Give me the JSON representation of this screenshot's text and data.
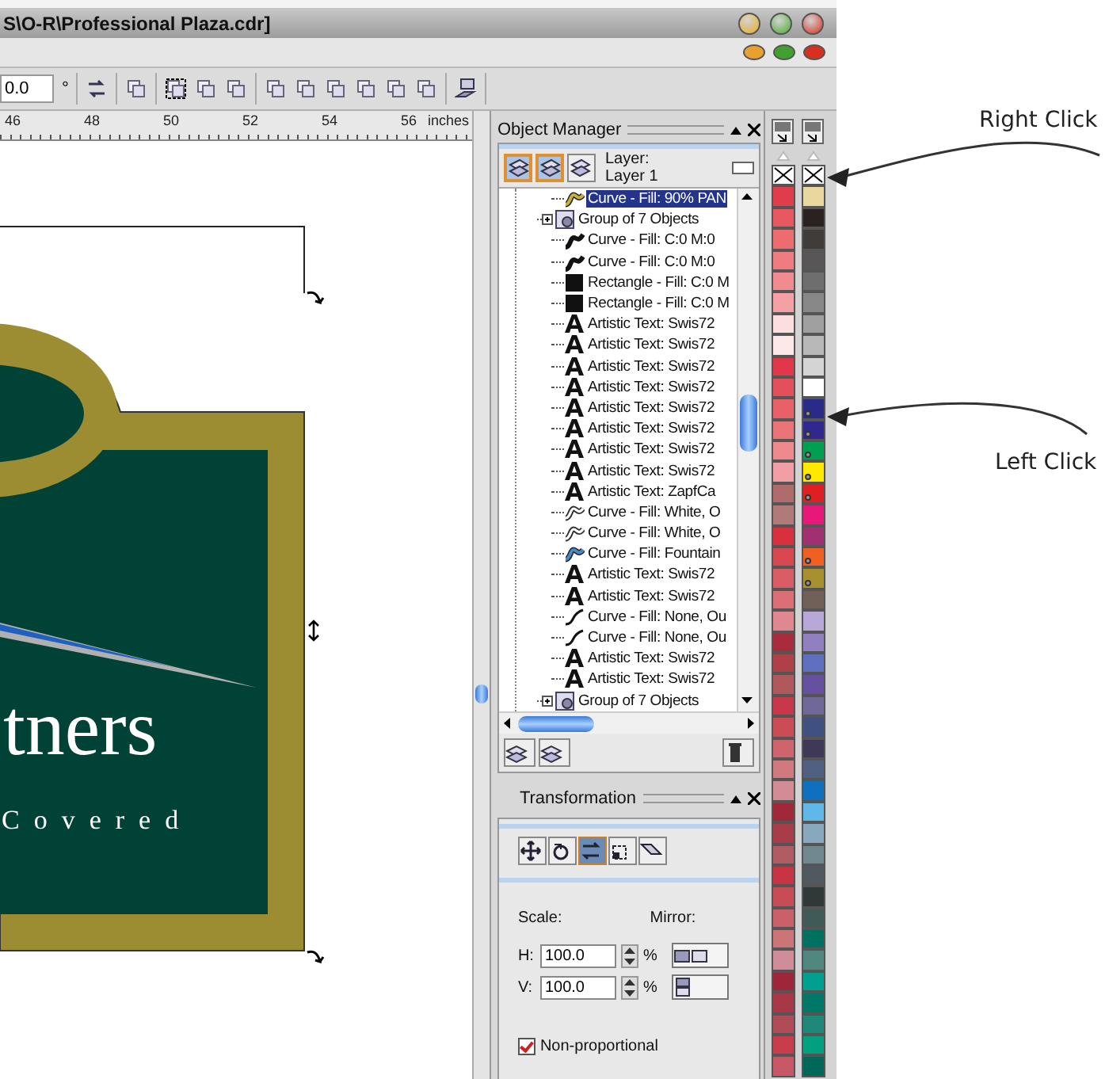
{
  "window": {
    "title": "S\\O-R\\Professional Plaza.cdr]"
  },
  "toolbar": {
    "angle_value": "0.0",
    "angle_unit": "°"
  },
  "ruler": {
    "labels": [
      "46",
      "48",
      "50",
      "52",
      "54",
      "56"
    ],
    "unit": "inches"
  },
  "canvas": {
    "texts": [
      "tners",
      "Covered"
    ]
  },
  "object_manager": {
    "title": "Object Manager",
    "layer_label": "Layer:",
    "layer_name": "Layer 1",
    "layer_buttons": [
      {
        "on": true
      },
      {
        "on": true
      },
      {
        "on": false
      }
    ],
    "rows": [
      {
        "label": "Curve - Fill: 90% PAN",
        "kind": "goldcurve",
        "selected": true
      },
      {
        "label": "Group of 7 Objects",
        "kind": "group",
        "selected": false,
        "expanded": false
      },
      {
        "label": "Curve - Fill: C:0 M:0",
        "kind": "blackcurve",
        "selected": false
      },
      {
        "label": "Curve - Fill: C:0 M:0",
        "kind": "blackcurve",
        "selected": false
      },
      {
        "label": "Rectangle - Fill: C:0 M",
        "kind": "rectangle",
        "selected": false
      },
      {
        "label": "Rectangle - Fill: C:0 M",
        "kind": "rectangle",
        "selected": false
      },
      {
        "label": "Artistic Text: Swis72",
        "kind": "text",
        "selected": false
      },
      {
        "label": "Artistic Text: Swis72",
        "kind": "text",
        "selected": false
      },
      {
        "label": "Artistic Text: Swis72",
        "kind": "text",
        "selected": false
      },
      {
        "label": "Artistic Text: Swis72",
        "kind": "text",
        "selected": false
      },
      {
        "label": "Artistic Text: Swis72",
        "kind": "text",
        "selected": false
      },
      {
        "label": "Artistic Text: Swis72",
        "kind": "text",
        "selected": false
      },
      {
        "label": "Artistic Text: Swis72",
        "kind": "text",
        "selected": false
      },
      {
        "label": "Artistic Text: Swis72",
        "kind": "text",
        "selected": false
      },
      {
        "label": "Artistic Text: ZapfCa",
        "kind": "text",
        "selected": false
      },
      {
        "label": "Curve - Fill: White, O",
        "kind": "whitecurve",
        "selected": false
      },
      {
        "label": "Curve - Fill: White, O",
        "kind": "whitecurve",
        "selected": false
      },
      {
        "label": "Curve - Fill: Fountain",
        "kind": "bluecurve",
        "selected": false
      },
      {
        "label": "Artistic Text: Swis72",
        "kind": "text",
        "selected": false
      },
      {
        "label": "Artistic Text: Swis72",
        "kind": "text",
        "selected": false
      },
      {
        "label": "Curve - Fill: None, Ou",
        "kind": "line",
        "selected": false
      },
      {
        "label": "Curve - Fill: None, Ou",
        "kind": "line",
        "selected": false
      },
      {
        "label": "Artistic Text: Swis72",
        "kind": "text",
        "selected": false
      },
      {
        "label": "Artistic Text: Swis72",
        "kind": "text",
        "selected": false
      },
      {
        "label": "Group of 7 Objects",
        "kind": "group",
        "selected": false,
        "expanded": false
      }
    ]
  },
  "transformation": {
    "title": "Transformation",
    "modes": [
      {
        "selected": false
      },
      {
        "selected": false
      },
      {
        "selected": true
      },
      {
        "selected": false
      },
      {
        "selected": false
      }
    ],
    "scale_label": "Scale:",
    "mirror_label": "Mirror:",
    "fields": [
      {
        "label": "H:",
        "value": "100.0",
        "unit": "%"
      },
      {
        "label": "V:",
        "value": "100.0",
        "unit": "%"
      }
    ],
    "non_proportional": {
      "label": "Non-proportional",
      "checked": true
    }
  },
  "palettes": [
    {
      "swatches": [
        {
          "kind": "none"
        },
        {
          "kind": "color",
          "color": "#e03c4c"
        },
        {
          "kind": "color",
          "color": "#e85860"
        },
        {
          "kind": "color",
          "color": "#ec6c70"
        },
        {
          "kind": "color",
          "color": "#ee7c80"
        },
        {
          "kind": "color",
          "color": "#f08c90"
        },
        {
          "kind": "color",
          "color": "#f4a0a4"
        },
        {
          "kind": "color",
          "color": "#fcdede"
        },
        {
          "kind": "color",
          "color": "#fce8e8"
        },
        {
          "kind": "color",
          "color": "#e0384a"
        },
        {
          "kind": "color",
          "color": "#e4505a"
        },
        {
          "kind": "color",
          "color": "#e86068"
        },
        {
          "kind": "color",
          "color": "#ea7478"
        },
        {
          "kind": "color",
          "color": "#ee8a8e"
        },
        {
          "kind": "color",
          "color": "#f0a0a4"
        },
        {
          "kind": "color",
          "color": "#b06c6c"
        },
        {
          "kind": "color",
          "color": "#b07a78"
        },
        {
          "kind": "color",
          "color": "#d8303e"
        },
        {
          "kind": "color",
          "color": "#d84850"
        },
        {
          "kind": "color",
          "color": "#da5c64"
        },
        {
          "kind": "color",
          "color": "#dc6e76"
        },
        {
          "kind": "color",
          "color": "#e08890"
        },
        {
          "kind": "color",
          "color": "#a82c3c"
        },
        {
          "kind": "color",
          "color": "#b04048"
        },
        {
          "kind": "color",
          "color": "#b0585c"
        },
        {
          "kind": "color",
          "color": "#c8384a"
        },
        {
          "kind": "color",
          "color": "#cc4c56"
        },
        {
          "kind": "color",
          "color": "#d0646c"
        },
        {
          "kind": "color",
          "color": "#d07a80"
        },
        {
          "kind": "color",
          "color": "#d48c94"
        },
        {
          "kind": "color",
          "color": "#a02838"
        },
        {
          "kind": "color",
          "color": "#a83c48"
        },
        {
          "kind": "color",
          "color": "#b05c62"
        },
        {
          "kind": "color",
          "color": "#c83444"
        },
        {
          "kind": "color",
          "color": "#c84c56"
        },
        {
          "kind": "color",
          "color": "#cc6068"
        },
        {
          "kind": "color",
          "color": "#cc7478"
        },
        {
          "kind": "color",
          "color": "#d08c98"
        },
        {
          "kind": "color",
          "color": "#a0243a"
        },
        {
          "kind": "color",
          "color": "#a83848"
        },
        {
          "kind": "color",
          "color": "#b04c58"
        },
        {
          "kind": "color",
          "color": "#c83c4c"
        },
        {
          "kind": "color",
          "color": "#c85868"
        }
      ]
    },
    {
      "swatches": [
        {
          "kind": "none",
          "marked": false
        },
        {
          "kind": "color",
          "color": "#e8d8a0",
          "marked": false
        },
        {
          "kind": "color",
          "color": "#2a2220",
          "marked": false
        },
        {
          "kind": "color",
          "color": "#403c3a",
          "marked": false
        },
        {
          "kind": "color",
          "color": "#585656",
          "marked": false
        },
        {
          "kind": "color",
          "color": "#6e6e6e",
          "marked": false
        },
        {
          "kind": "color",
          "color": "#888888",
          "marked": false
        },
        {
          "kind": "color",
          "color": "#a0a0a0",
          "marked": false
        },
        {
          "kind": "color",
          "color": "#b8b8b8",
          "marked": false
        },
        {
          "kind": "color",
          "color": "#d4d4d4",
          "marked": false
        },
        {
          "kind": "color",
          "color": "#ffffff",
          "marked": false
        },
        {
          "kind": "color",
          "color": "#2a2a88",
          "marked": true
        },
        {
          "kind": "color",
          "color": "#30288e",
          "marked": true
        },
        {
          "kind": "color",
          "color": "#00a050",
          "marked": true
        },
        {
          "kind": "color",
          "color": "#ffe800",
          "marked": true
        },
        {
          "kind": "color",
          "color": "#e02020",
          "marked": true
        },
        {
          "kind": "color",
          "color": "#e81878",
          "marked": false
        },
        {
          "kind": "color",
          "color": "#a03070",
          "marked": false
        },
        {
          "kind": "color",
          "color": "#f06020",
          "marked": true
        },
        {
          "kind": "color",
          "color": "#a89030",
          "marked": true
        },
        {
          "kind": "color",
          "color": "#706058",
          "marked": false
        },
        {
          "kind": "color",
          "color": "#b8a8d8",
          "marked": false
        },
        {
          "kind": "color",
          "color": "#9080c0",
          "marked": false
        },
        {
          "kind": "color",
          "color": "#6070c0",
          "marked": false
        },
        {
          "kind": "color",
          "color": "#6850a0",
          "marked": false
        },
        {
          "kind": "color",
          "color": "#706898",
          "marked": false
        },
        {
          "kind": "color",
          "color": "#405080",
          "marked": false
        },
        {
          "kind": "color",
          "color": "#403858",
          "marked": false
        },
        {
          "kind": "color",
          "color": "#506080",
          "marked": false
        },
        {
          "kind": "color",
          "color": "#1070c0",
          "marked": false
        },
        {
          "kind": "color",
          "color": "#60b8e8",
          "marked": false
        },
        {
          "kind": "color",
          "color": "#88a8c0",
          "marked": false
        },
        {
          "kind": "color",
          "color": "#708890",
          "marked": false
        },
        {
          "kind": "color",
          "color": "#505860",
          "marked": false
        },
        {
          "kind": "color",
          "color": "#303838",
          "marked": false
        },
        {
          "kind": "color",
          "color": "#405a58",
          "marked": false
        },
        {
          "kind": "color",
          "color": "#007060",
          "marked": false
        },
        {
          "kind": "color",
          "color": "#508880",
          "marked": false
        },
        {
          "kind": "color",
          "color": "#00a090",
          "marked": false
        },
        {
          "kind": "color",
          "color": "#007868",
          "marked": false
        },
        {
          "kind": "color",
          "color": "#208878",
          "marked": false
        },
        {
          "kind": "color",
          "color": "#00a080",
          "marked": false
        },
        {
          "kind": "color",
          "color": "#006858",
          "marked": false
        }
      ]
    }
  ],
  "annotations": [
    {
      "text": "Right Click"
    },
    {
      "text": "Left Click"
    }
  ]
}
